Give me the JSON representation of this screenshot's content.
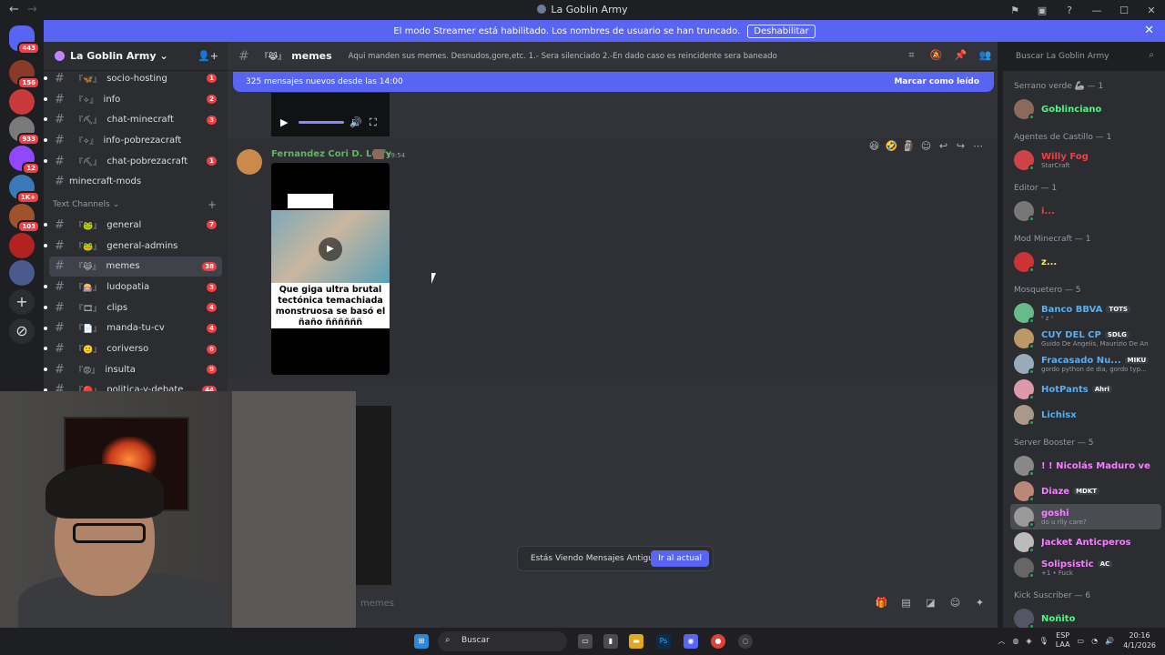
{
  "window": {
    "title": "La Goblin Army",
    "back_icon": "arrow-left-icon",
    "forward_icon": "arrow-right-icon"
  },
  "banner": {
    "text": "El modo Streamer está habilitado. Los nombres de usuario se han truncado.",
    "button": "Deshabilitar"
  },
  "server_rail": {
    "home_badge": "443",
    "servers": [
      {
        "badge": "156"
      },
      {
        "badge": ""
      },
      {
        "badge": "933"
      },
      {
        "badge": "12"
      },
      {
        "badge": "1K+"
      },
      {
        "badge": "103"
      },
      {
        "badge": ""
      },
      {
        "badge": ""
      }
    ]
  },
  "guild": {
    "name": "La Goblin Army"
  },
  "channels_top": [
    {
      "emoji": "『🦋』",
      "name": "socio-hosting",
      "count": "1"
    },
    {
      "emoji": "『✧』",
      "name": "info",
      "count": "2"
    },
    {
      "emoji": "『⛏』",
      "name": "chat-minecraft",
      "count": "3"
    },
    {
      "emoji": "『✧』",
      "name": "info-pobrezacraft",
      "count": ""
    },
    {
      "emoji": "『⛏』",
      "name": "chat-pobrezacraft",
      "count": "1"
    }
  ],
  "plain_channel": "minecraft-mods",
  "category": "Text Channels",
  "channels_text": [
    {
      "emoji": "『🐸』",
      "name": "general",
      "count": "7"
    },
    {
      "emoji": "『🐸』",
      "name": "general-admins",
      "count": ""
    },
    {
      "emoji": "『😹』",
      "name": "memes",
      "count": "38"
    },
    {
      "emoji": "『🎰』",
      "name": "ludopatia",
      "count": "3"
    },
    {
      "emoji": "『🎞』",
      "name": "clips",
      "count": "4"
    },
    {
      "emoji": "『📄』",
      "name": "manda-tu-cv",
      "count": "4"
    },
    {
      "emoji": "『🙂』",
      "name": "coriverso",
      "count": "6"
    },
    {
      "emoji": "『😡』",
      "name": "insulta",
      "count": "9"
    },
    {
      "emoji": "『🔴』",
      "name": "politica-y-debate",
      "count": "44"
    }
  ],
  "channel_header": {
    "emoji": "『😹』",
    "name": "memes",
    "topic": "Aqui manden sus memes. Desnudos,gore,etc. 1.- Sera silenciado 2.-En dado caso es reincidente sera baneado",
    "search_placeholder": "Buscar La Goblin Army"
  },
  "new_messages": {
    "text": "325 mensajes nuevos desde las 14:00",
    "mark_read": "Marcar como leído"
  },
  "message": {
    "author": "Fernandez Cori D. Luffy",
    "time": "19:54",
    "video_caption": "Que giga ultra brutal tectónica temachiada monstruosa se basó el ñaño ññññññ"
  },
  "old_messages": {
    "text": "Estás Viendo Mensajes Antiguos",
    "jump": "Ir al actual"
  },
  "composer": {
    "placeholder": "memes"
  },
  "members": {
    "groups": [
      {
        "title": "Serrano verde 🦾 — 1",
        "members": [
          {
            "name": "Goblinciano",
            "color": "#57f287",
            "sub": "",
            "tag": ""
          }
        ]
      },
      {
        "title": "Agentes de Castillo — 1",
        "members": [
          {
            "name": "Willy Fog",
            "color": "#ed4245",
            "sub": "StarCraft",
            "tag": ""
          }
        ]
      },
      {
        "title": "Editor — 1",
        "members": [
          {
            "name": "i...",
            "color": "#ed4245",
            "sub": "",
            "tag": ""
          }
        ]
      },
      {
        "title": "Mod Minecraft — 1",
        "members": [
          {
            "name": "z...",
            "color": "#fee75c",
            "sub": "",
            "tag": ""
          }
        ]
      },
      {
        "title": "Mosquetero — 5",
        "members": [
          {
            "name": "Banco BBVA",
            "color": "#5dadec",
            "sub": "ᶻ z ᶻ",
            "tag": "TOTS"
          },
          {
            "name": "CUY DEL CP",
            "color": "#5dadec",
            "sub": "Guido De Angelis, Maurizio De An",
            "tag": "SDLG"
          },
          {
            "name": "Fracasado Nu...",
            "color": "#5dadec",
            "sub": "gordo python de dia, gordo typ...",
            "tag": "MIKU"
          },
          {
            "name": "HotPants",
            "color": "#5dadec",
            "sub": "",
            "tag": "Ahri"
          },
          {
            "name": "Lichisx",
            "color": "#5dadec",
            "sub": "",
            "tag": ""
          }
        ]
      },
      {
        "title": "Server Booster — 5",
        "members": [
          {
            "name": "! ! Nicolás Maduro ve",
            "color": "#f47fff",
            "sub": "",
            "tag": ""
          },
          {
            "name": "Diaze",
            "color": "#f47fff",
            "sub": "",
            "tag": "MDKT"
          },
          {
            "name": "goshi",
            "color": "#f47fff",
            "sub": "do u rlly care?",
            "tag": ""
          },
          {
            "name": "Jacket Anticperos",
            "color": "#f47fff",
            "sub": "",
            "tag": ""
          },
          {
            "name": "Solipsistic",
            "color": "#f47fff",
            "sub": "+1 • Fuck",
            "tag": "AC"
          }
        ]
      },
      {
        "title": "Kick Suscriber — 6",
        "members": [
          {
            "name": "Ñoñito",
            "color": "#57f287",
            "sub": "",
            "tag": ""
          }
        ]
      }
    ]
  },
  "taskbar": {
    "search": "Buscar",
    "lang_top": "ESP",
    "lang_bottom": "LAA",
    "time": "20:16",
    "date": "4/1/2026"
  }
}
